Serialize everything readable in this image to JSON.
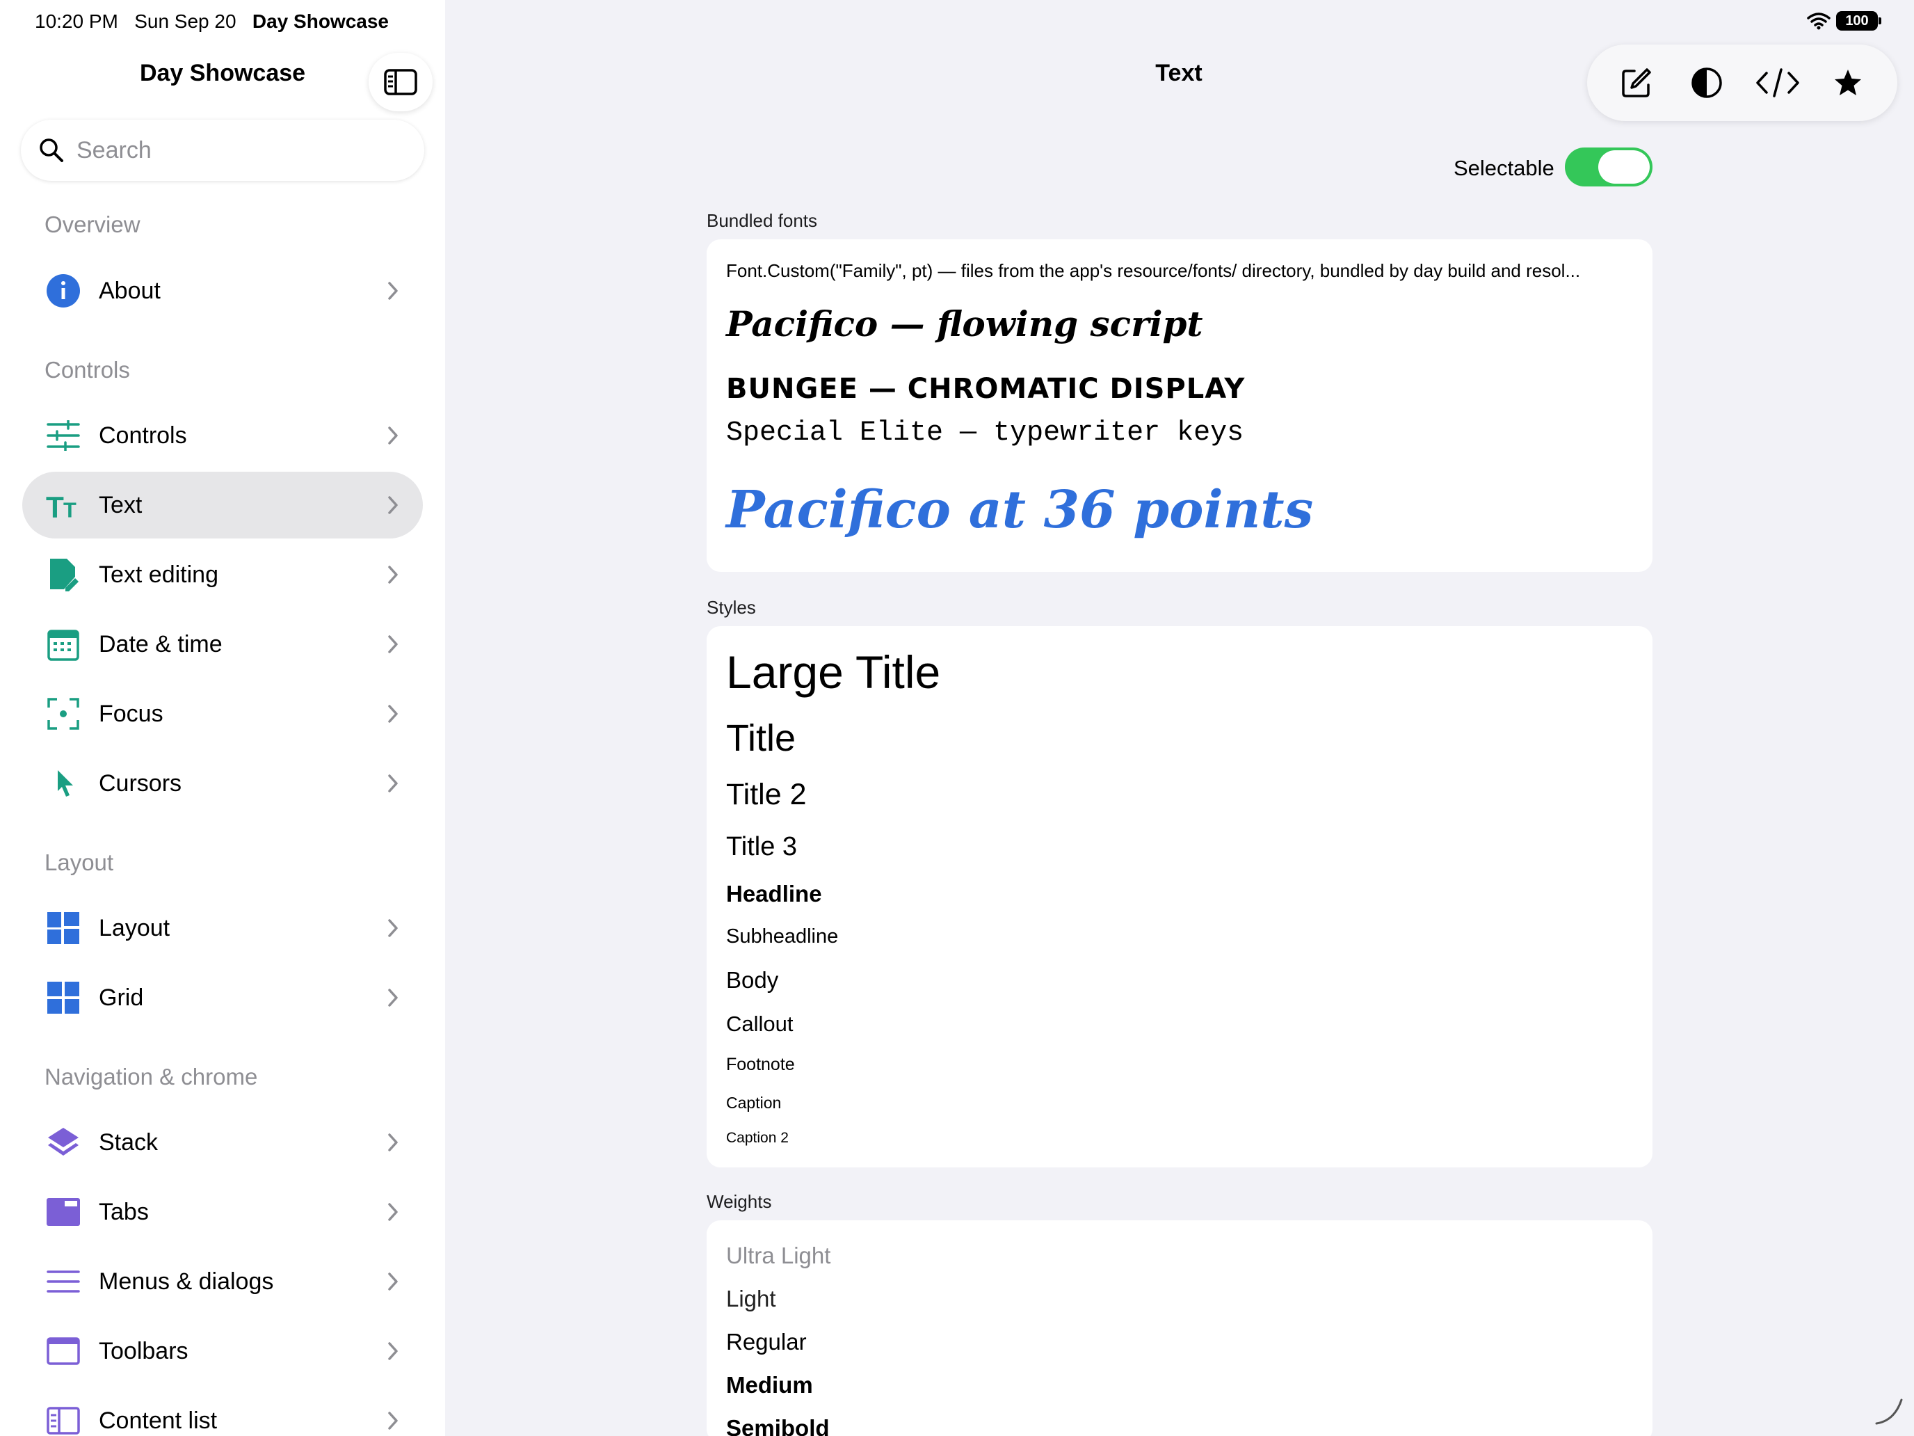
{
  "status_bar": {
    "time": "10:20 PM",
    "date": "Sun Sep 20",
    "app": "Day Showcase",
    "battery": "100"
  },
  "sidebar": {
    "title": "Day Showcase",
    "search_placeholder": "Search",
    "sections": {
      "overview": "Overview",
      "controls": "Controls",
      "layout": "Layout",
      "navigation": "Navigation & chrome"
    },
    "items": {
      "about": "About",
      "controls": "Controls",
      "text": "Text",
      "text_editing": "Text editing",
      "date_time": "Date & time",
      "focus": "Focus",
      "cursors": "Cursors",
      "layout": "Layout",
      "grid": "Grid",
      "stack": "Stack",
      "tabs": "Tabs",
      "menus_dialogs": "Menus & dialogs",
      "toolbars": "Toolbars",
      "content_list": "Content list"
    },
    "selected": "text",
    "accent_teal": "#1a9e82",
    "accent_blue": "#2f6fdb",
    "accent_purple": "#7b5fd6"
  },
  "main": {
    "title": "Text",
    "selectable_label": "Selectable",
    "selectable_on": true,
    "bundled_fonts": {
      "header": "Bundled fonts",
      "description": "Font.Custom(\"Family\", pt) — files from the app's resource/fonts/ directory, bundled by day build and resol...",
      "pacifico": "Pacifico — flowing script",
      "bungee": "BUNGEE — CHROMATIC DISPLAY",
      "special_elite": "Special Elite — typewriter keys",
      "pacifico_large": "Pacifico at 36 points"
    },
    "styles": {
      "header": "Styles",
      "large_title": "Large Title",
      "title": "Title",
      "title2": "Title 2",
      "title3": "Title 3",
      "headline": "Headline",
      "subheadline": "Subheadline",
      "body": "Body",
      "callout": "Callout",
      "footnote": "Footnote",
      "caption": "Caption",
      "caption2": "Caption 2"
    },
    "weights": {
      "header": "Weights",
      "ultra_light": "Ultra Light",
      "light": "Light",
      "regular": "Regular",
      "medium": "Medium",
      "semibold": "Semibold"
    }
  }
}
